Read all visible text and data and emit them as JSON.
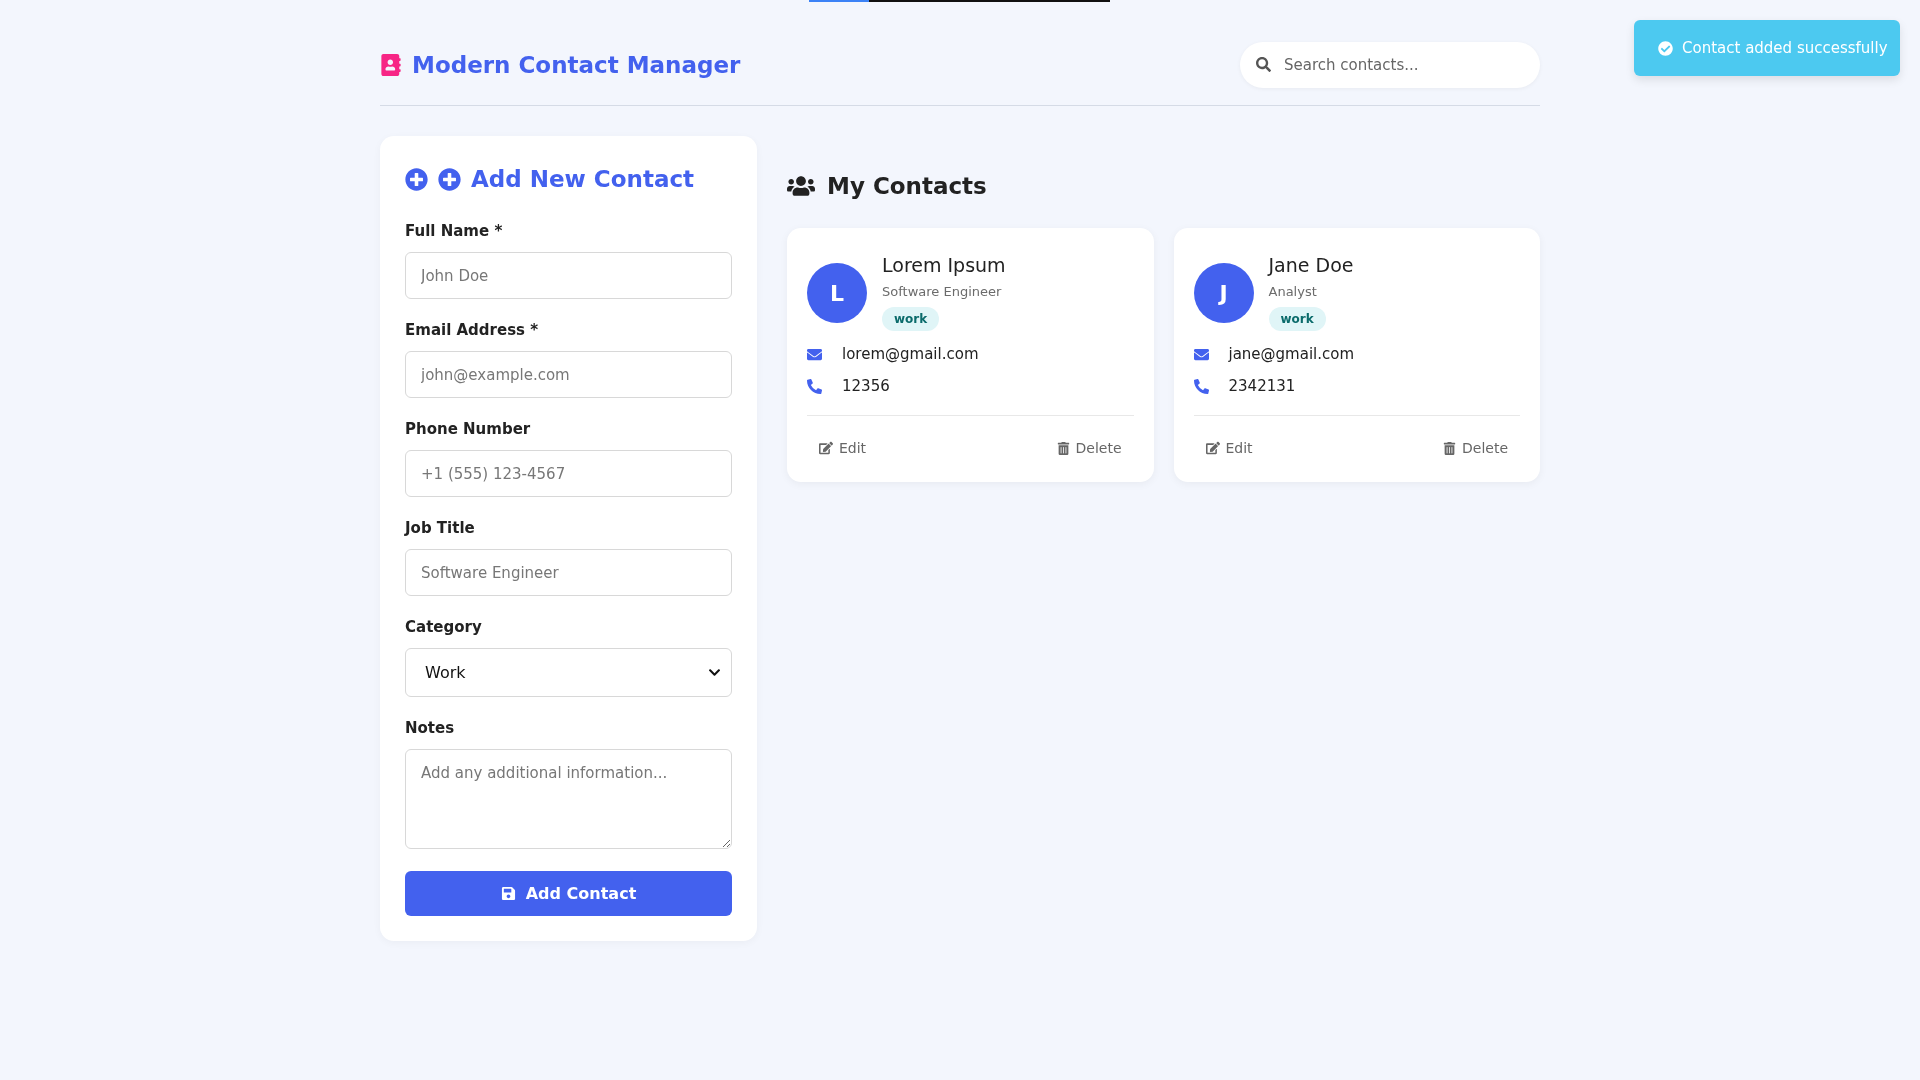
{
  "load_bar": {
    "level": 0.2
  },
  "header": {
    "title": "Modern Contact Manager",
    "search": {
      "placeholder": "Search contacts..."
    }
  },
  "toast": {
    "message": "Contact added successfully"
  },
  "form": {
    "title": "Add New Contact",
    "fields": [
      {
        "kind": "input",
        "label": "Full Name *",
        "placeholder": "John Doe"
      },
      {
        "kind": "input",
        "label": "Email Address *",
        "placeholder": "john@example.com"
      },
      {
        "kind": "input",
        "label": "Phone Number",
        "placeholder": "+1 (555) 123-4567"
      },
      {
        "kind": "input",
        "label": "Job Title",
        "placeholder": "Software Engineer"
      },
      {
        "kind": "select",
        "label": "Category",
        "value": "Work"
      },
      {
        "kind": "textarea",
        "label": "Notes",
        "placeholder": "Add any additional information..."
      }
    ],
    "submit": "Add Contact"
  },
  "contacts": {
    "title": "My Contacts",
    "items": [
      {
        "initial": "L",
        "name": "Lorem Ipsum",
        "job": "Software Engineer",
        "tag": "work",
        "email": "lorem@gmail.com",
        "phone": "12356",
        "edit": "Edit",
        "delete": "Delete"
      },
      {
        "initial": "J",
        "name": "Jane Doe",
        "job": "Analyst",
        "tag": "work",
        "email": "jane@gmail.com",
        "phone": "2342131",
        "edit": "Edit",
        "delete": "Delete"
      }
    ]
  }
}
